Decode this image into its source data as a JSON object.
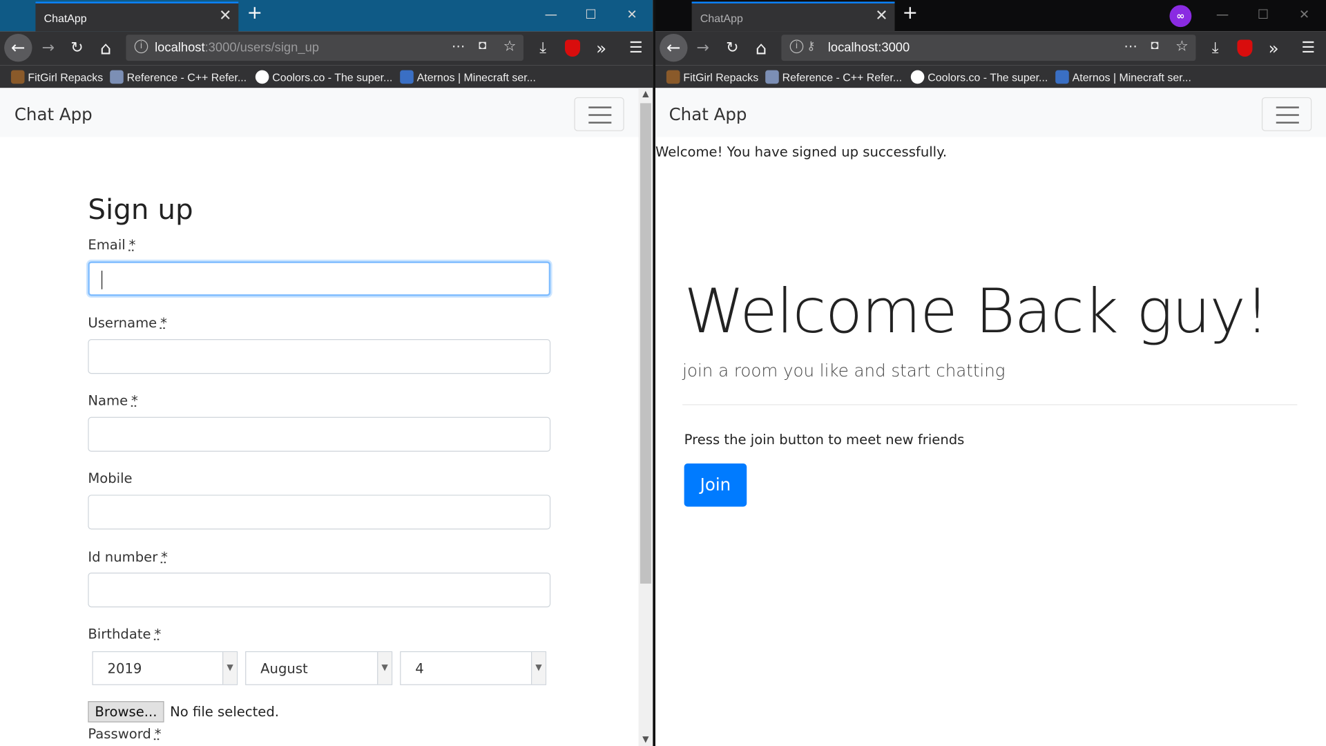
{
  "left_window": {
    "tab_title": "ChatApp",
    "url_host": "localhost",
    "url_path": ":3000/users/sign_up",
    "bookmarks": [
      "FitGirl Repacks",
      "Reference - C++ Refer...",
      "Coolors.co - The super...",
      "Aternos | Minecraft ser..."
    ],
    "brand": "Chat App",
    "form": {
      "title": "Sign up",
      "email_label": "Email",
      "username_label": "Username",
      "name_label": "Name",
      "mobile_label": "Mobile",
      "id_number_label": "Id number",
      "birthdate_label": "Birthdate",
      "required_mark": "*",
      "year": "2019",
      "month": "August",
      "day": "4",
      "browse_label": "Browse...",
      "no_file": "No file selected.",
      "password_label": "Password"
    }
  },
  "right_window": {
    "tab_title": "ChatApp",
    "url": "localhost:3000",
    "bookmarks": [
      "FitGirl Repacks",
      "Reference - C++ Refer...",
      "Coolors.co - The super...",
      "Aternos | Minecraft ser..."
    ],
    "brand": "Chat App",
    "flash": "Welcome! You have signed up successfully.",
    "hero_title": "Welcome Back guy!",
    "hero_lead": "join a room you like and start chatting",
    "hero_text": "Press the join button to meet new friends",
    "join_label": "Join"
  },
  "icons": {
    "tab_close": "✕",
    "new_tab": "+",
    "minimize": "—",
    "maximize": "☐",
    "close": "✕",
    "back": "←",
    "forward": "→",
    "reload": "↻",
    "home": "⌂",
    "page_actions": "⋯",
    "download": "⤓",
    "overflow": "»",
    "menu": "☰"
  },
  "colors": {
    "left_titlebar": "#0f5a86",
    "right_titlebar": "#0c0c0d",
    "primary": "#007bff",
    "focus_border": "#80bdff"
  }
}
